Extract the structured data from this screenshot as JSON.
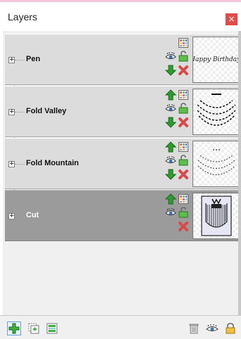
{
  "window": {
    "title": "Layers",
    "close_label": "×"
  },
  "layers": [
    {
      "name": "Pen",
      "selected": false,
      "has_move_up": false,
      "has_move_down": true,
      "thumbnail": "pen-thumbnail-icon",
      "thumbnail_text": "Happy Birthday!"
    },
    {
      "name": "Fold Valley",
      "selected": false,
      "has_move_up": true,
      "has_move_down": true,
      "thumbnail": "fold-valley-thumbnail-icon"
    },
    {
      "name": "Fold Mountain",
      "selected": false,
      "has_move_up": true,
      "has_move_down": true,
      "thumbnail": "fold-mountain-thumbnail-icon"
    },
    {
      "name": "Cut",
      "selected": true,
      "has_move_up": true,
      "has_move_down": false,
      "thumbnail": "cut-thumbnail-icon"
    }
  ],
  "layer_buttons": [
    "move-up-icon",
    "color-grid-icon",
    "visibility-eye-icon",
    "lock-open-icon",
    "move-down-icon",
    "delete-x-icon"
  ],
  "bottom_toolbar": [
    "add-layer-icon",
    "duplicate-layer-icon",
    "layer-properties-icon",
    "trash-icon",
    "visibility-eye-icon",
    "lock-icon"
  ],
  "colors": {
    "selected_row": "#9b9b9b",
    "row": "#dcdcdc",
    "arrow_green": "#2e9c2e",
    "delete_red": "#d94a4a",
    "close_red": "#e24a4a"
  }
}
